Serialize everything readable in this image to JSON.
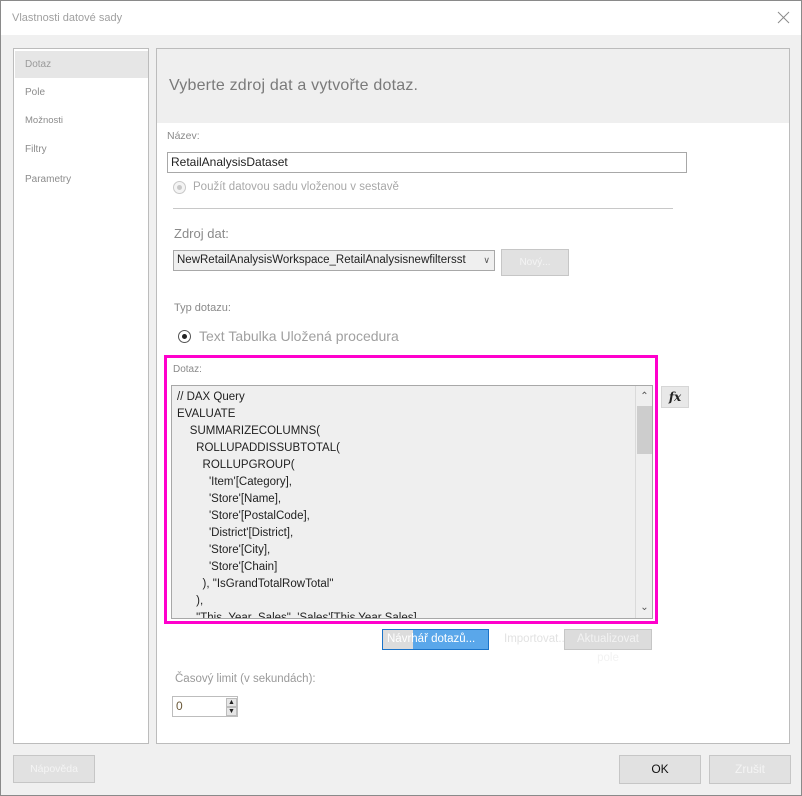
{
  "window": {
    "title": "Vlastnosti datové sady",
    "close_icon": "close-icon"
  },
  "sidebar": {
    "items": [
      {
        "label": "Dotaz",
        "active": true
      },
      {
        "label": "Pole",
        "active": false
      },
      {
        "label": "Možnosti",
        "active": false
      },
      {
        "label": "Filtry",
        "active": false
      },
      {
        "label": "Parametry",
        "active": false
      }
    ]
  },
  "main": {
    "header": "Vyberte zdroj dat a vytvořte dotaz.",
    "name_label": "Název:",
    "name_value": "RetailAnalysisDataset",
    "embedded_option": "Použít datovou sadu vloženou v sestavě",
    "datasource_label": "Zdroj dat:",
    "datasource_value": "NewRetailAnalysisWorkspace_RetailAnalysisnewfiltersst",
    "new_button": "Nový...",
    "query_type_label": "Typ dotazu:",
    "query_types": [
      "Text",
      "Tabulka",
      "Uložená procedura"
    ],
    "query_types_text": "Text Tabulka Uložená procedura",
    "query_label": "Dotaz:",
    "query_text": "// DAX Query\nEVALUATE\n    SUMMARIZECOLUMNS(\n      ROLLUPADDISSUBTOTAL(\n        ROLLUPGROUP(\n          'Item'[Category],\n          'Store'[Name],\n          'Store'[PostalCode],\n          'District'[District],\n          'Store'[City],\n          'Store'[Chain]\n        ), \"IsGrandTotalRowTotal\"\n      ),\n      \"This_Year_Sales\", 'Sales'[This Year Sales]",
    "fx_button": "fx",
    "query_designer_button": "Návrhář dotazů...",
    "import_button": "Importovat...",
    "refresh_fields_button": "Aktualizovat pole",
    "timeout_label": "Časový limit (v sekundách):",
    "timeout_value": "0"
  },
  "footer": {
    "help_button": "Nápověda",
    "ok_button": "OK",
    "cancel_button": "Zrušit"
  },
  "colors": {
    "highlight_frame": "#ff00cc",
    "query_designer_bg": "#5aa7ea"
  }
}
